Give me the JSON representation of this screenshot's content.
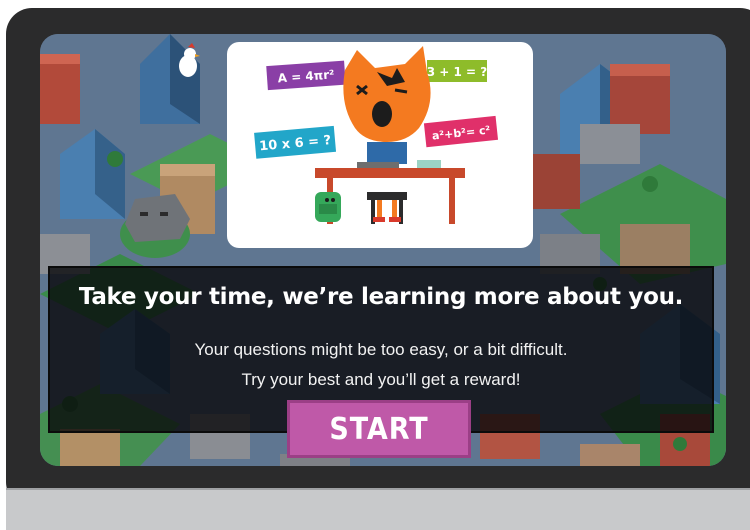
{
  "dialog": {
    "heading": "Take your time, we’re learning more about you.",
    "line1": "Your questions might be too easy, or a bit difficult.",
    "line2": "Try your best and you’ll get a reward!"
  },
  "start_button": {
    "label": "START"
  },
  "illustration": {
    "formulas": {
      "area": "A = 4πr²",
      "addition": "3 + 1 = ?",
      "multiplication": "10 x 6 = ?",
      "pythagoras": "a²+b²= c²"
    },
    "formula_colors": {
      "area": "#8a3fa6",
      "addition": "#8ebc2a",
      "multiplication": "#22a6c9",
      "pythagoras": "#e0306a"
    }
  },
  "colors": {
    "device_frame": "#2b2b2c",
    "device_base": "#c8c9cb",
    "start_button": "#bf59a8",
    "character": "#f47a20"
  },
  "icons": [
    "city-background",
    "chicken-icon",
    "backpack-icon",
    "character-icon"
  ]
}
